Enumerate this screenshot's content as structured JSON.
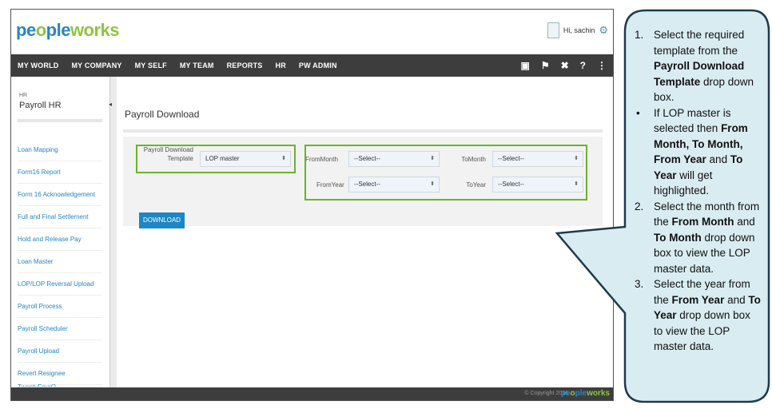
{
  "app": {
    "logo": {
      "part1": "pe",
      "part2": "o",
      "part3": "ple",
      "part4": "works"
    },
    "greeting": "Hi, sachin",
    "nav": [
      "MY WORLD",
      "MY COMPANY",
      "MY SELF",
      "MY TEAM",
      "REPORTS",
      "HR",
      "PW ADMIN"
    ],
    "nav_icons": [
      "book-icon",
      "flag-icon",
      "tools-icon",
      "help-icon",
      "network-icon"
    ],
    "sidebar": {
      "section_small": "HR",
      "section": "Payroll HR",
      "items": [
        "Loan Mapping",
        "Form16 Report",
        "Form 16 Acknowledgement",
        "Full and Final Settlement",
        "Hold and Release Pay",
        "Loan Master",
        "LOP/LOP Reversal Upload",
        "Payroll Process",
        "Payroll Scheduler",
        "Payroll Upload",
        "Revert Resignee",
        "TwentyFourQ"
      ]
    },
    "page_title": "Payroll Download",
    "form": {
      "template_label_1": "Payroll Download",
      "template_label_2": "Template",
      "template_value": "LOP master",
      "from_month_label": "FromMonth",
      "from_month_value": "--Select--",
      "to_month_label": "ToMonth",
      "to_month_value": "--Select--",
      "from_year_label": "FromYear",
      "from_year_value": "--Select--",
      "to_year_label": "ToYear",
      "to_year_value": "--Select--",
      "download_label": "DOWNLOAD"
    },
    "footer": {
      "copyright": "© Copyright 2016"
    },
    "colors": {
      "accent": "#1b87c5",
      "highlight": "#6bb32e",
      "nav_bg": "#3d3d3d",
      "callout_bg": "#d9ecf2"
    }
  },
  "callout": {
    "s1_marker": "1.",
    "s1_a": "Select the required template from the ",
    "s1_b": "Payroll Download Template",
    "s1_c": " drop down box.",
    "s2_marker": "•",
    "s2_a": "If LOP master is selected then ",
    "s2_b": "From Month, To Month, From Year",
    "s2_c": " and ",
    "s2_d": "To Year",
    "s2_e": " will get highlighted.",
    "s3_marker": "2.",
    "s3_a": "Select the month from the ",
    "s3_b": "From Month",
    "s3_c": " and ",
    "s3_d": "To Month",
    "s3_e": " drop down box to view the LOP master data.",
    "s4_marker": "3.",
    "s4_a": "Select the year from the ",
    "s4_b": "From Year",
    "s4_c": " and ",
    "s4_d": "To Year",
    "s4_e": " drop down box to view the LOP master data."
  }
}
